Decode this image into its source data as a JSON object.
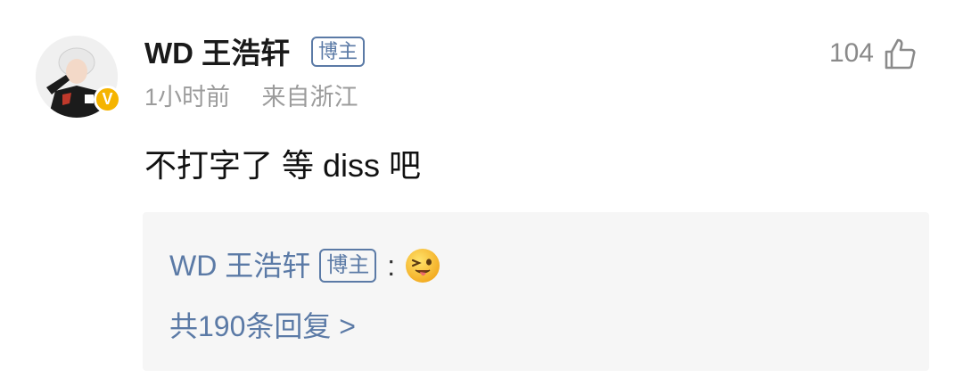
{
  "comment": {
    "username": "WD 王浩轩",
    "badge": "博主",
    "time": "1小时前",
    "location": "来自浙江",
    "likes": "104",
    "text": "不打字了 等 diss 吧"
  },
  "reply": {
    "username": "WD 王浩轩",
    "badge": "博主",
    "colon": ":",
    "emoji": "wink-tongue-emoji",
    "count_text": "共190条回复 >"
  },
  "icons": {
    "like": "thumbs-up-icon",
    "verified": "verified-v-icon"
  },
  "colors": {
    "link_blue": "#5b7aa6",
    "verified_gold": "#f5b400",
    "meta_gray": "#9c9c9c",
    "reply_bg": "#f6f6f6"
  }
}
